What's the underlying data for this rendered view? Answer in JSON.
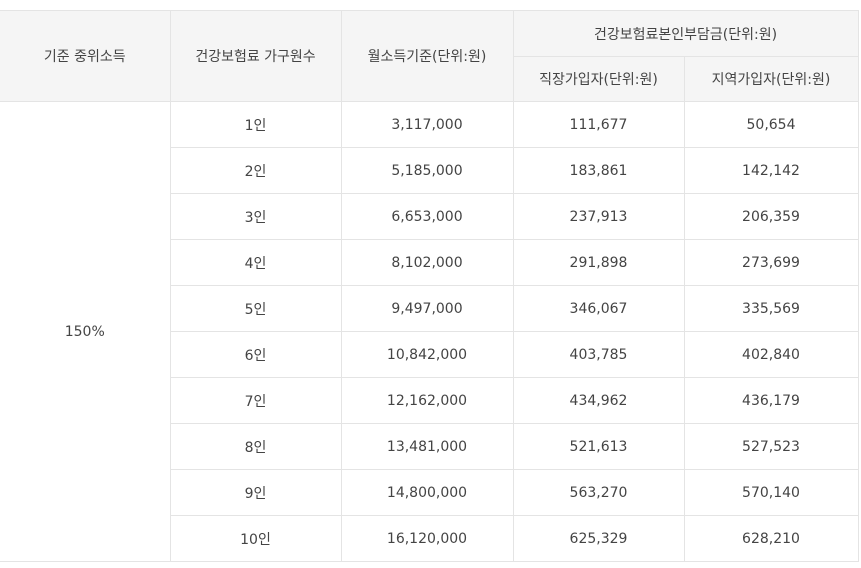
{
  "table": {
    "headers": {
      "standard_income": "기준 중위소득",
      "household_size": "건강보험료 가구원수",
      "monthly_income": "월소득기준(단위:원)",
      "premium_group": "건강보험료본인부담금(단위:원)",
      "employee": "직장가입자(단위:원)",
      "regional": "지역가입자(단위:원)"
    },
    "group_label": "150%",
    "rows": [
      {
        "household": "1인",
        "monthly": "3,117,000",
        "employee": "111,677",
        "regional": "50,654"
      },
      {
        "household": "2인",
        "monthly": "5,185,000",
        "employee": "183,861",
        "regional": "142,142"
      },
      {
        "household": "3인",
        "monthly": "6,653,000",
        "employee": "237,913",
        "regional": "206,359"
      },
      {
        "household": "4인",
        "monthly": "8,102,000",
        "employee": "291,898",
        "regional": "273,699"
      },
      {
        "household": "5인",
        "monthly": "9,497,000",
        "employee": "346,067",
        "regional": "335,569"
      },
      {
        "household": "6인",
        "monthly": "10,842,000",
        "employee": "403,785",
        "regional": "402,840"
      },
      {
        "household": "7인",
        "monthly": "12,162,000",
        "employee": "434,962",
        "regional": "436,179"
      },
      {
        "household": "8인",
        "monthly": "13,481,000",
        "employee": "521,613",
        "regional": "527,523"
      },
      {
        "household": "9인",
        "monthly": "14,800,000",
        "employee": "563,270",
        "regional": "570,140"
      },
      {
        "household": "10인",
        "monthly": "16,120,000",
        "employee": "625,329",
        "regional": "628,210"
      }
    ]
  }
}
